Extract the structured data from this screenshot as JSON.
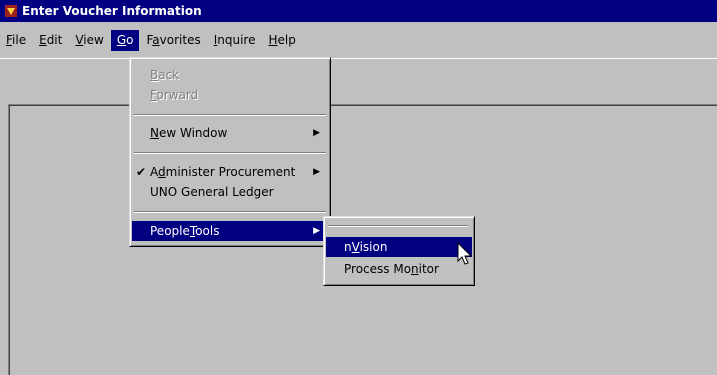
{
  "window": {
    "title": "Enter Voucher Information"
  },
  "menubar": {
    "items": [
      {
        "label": "File",
        "key": "F",
        "rest": "ile"
      },
      {
        "label": "Edit",
        "key": "E",
        "rest": "dit"
      },
      {
        "label": "View",
        "key": "V",
        "rest": "iew"
      },
      {
        "label": "Go",
        "key": "G",
        "rest": "o"
      },
      {
        "label": "Favorites",
        "pre": "F",
        "key": "a",
        "rest": "vorites"
      },
      {
        "label": "Inquire",
        "key": "I",
        "rest": "nquire"
      },
      {
        "label": "Help",
        "key": "H",
        "rest": "elp"
      }
    ]
  },
  "go_menu": {
    "back": {
      "key": "B",
      "rest": "ack"
    },
    "forward": {
      "key": "F",
      "rest": "orward"
    },
    "new_window": {
      "key": "N",
      "rest": "ew Window"
    },
    "administer": {
      "pre": "A",
      "key": "d",
      "rest": "minister Procurement"
    },
    "uno": "UNO General Ledger",
    "peopletools": {
      "pre": "People",
      "key": "T",
      "rest": "ools"
    }
  },
  "peopletools_submenu": {
    "nvision": {
      "pre": "n",
      "key": "V",
      "rest": "ision"
    },
    "process_monitor": {
      "pre": "Process Mo",
      "key": "n",
      "rest": "itor"
    }
  },
  "toolbar": {
    "icons": [
      "save-icon",
      "gear-icon",
      "gear-alert-icon",
      "delete-icon",
      "button-5-icon",
      "button-6-icon",
      "next-list-icon",
      "prev-list-icon",
      "search-icon",
      "back-arrow-icon",
      "forward-arrow-icon",
      "add-icon",
      "check-icon",
      "check-update-icon",
      "edit-icon"
    ]
  },
  "colors": {
    "title_bg": "#000080",
    "face": "#c0c0c0",
    "highlight": "#000080"
  }
}
